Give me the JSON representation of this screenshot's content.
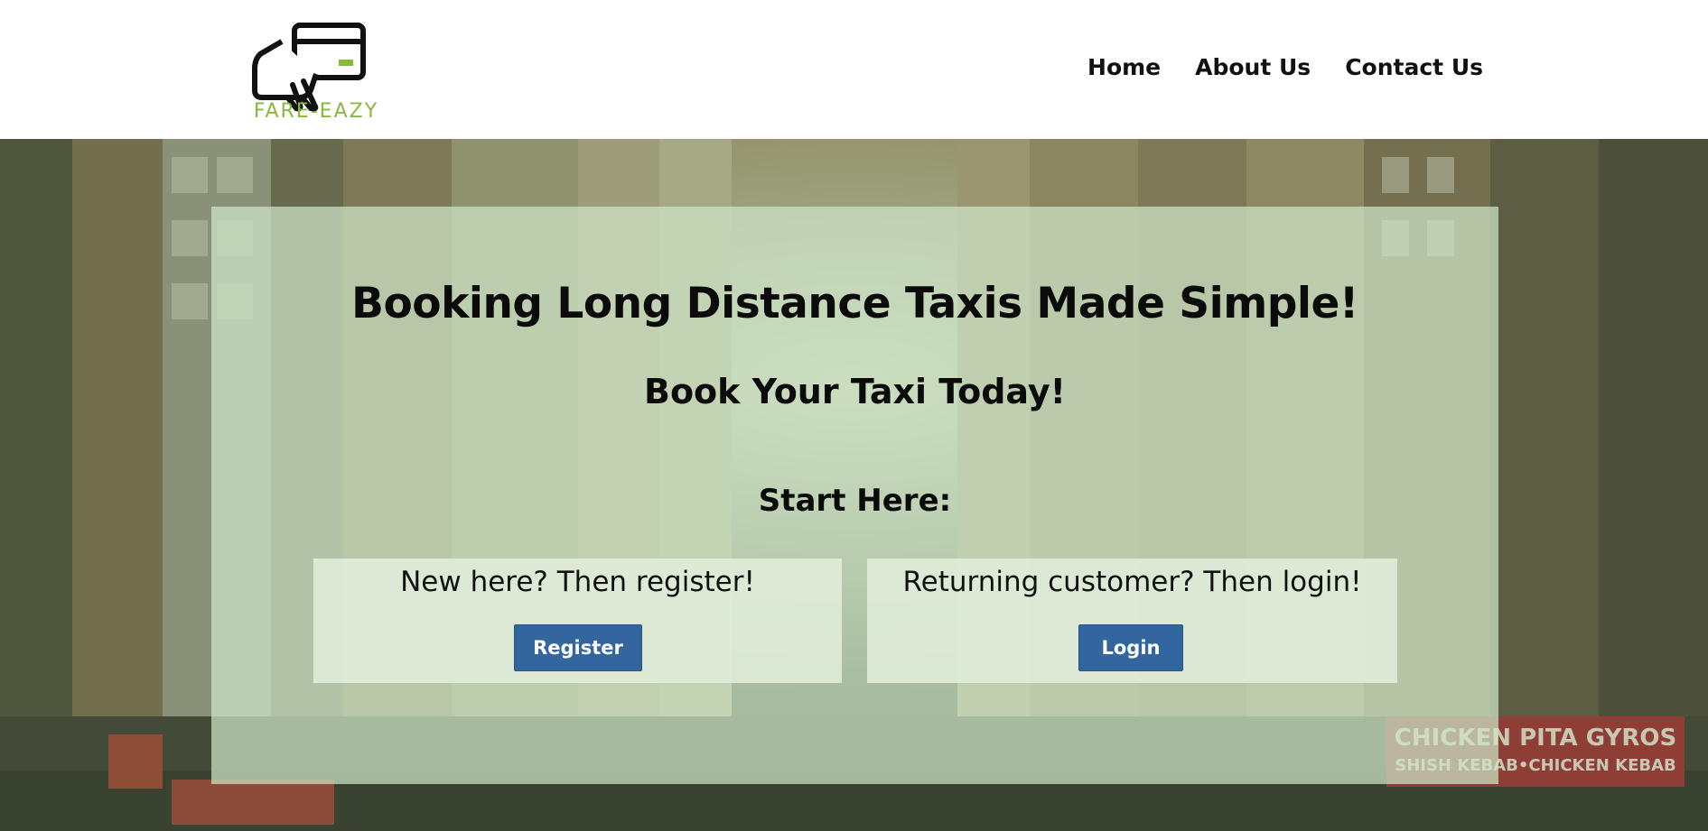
{
  "header": {
    "logo_text": "FARE-EAZY",
    "nav": [
      {
        "label": "Home"
      },
      {
        "label": "About Us"
      },
      {
        "label": "Contact Us"
      }
    ]
  },
  "hero": {
    "headline": "Booking Long Distance Taxis Made Simple!",
    "subheadline": "Book Your Taxi Today!",
    "start_label": "Start Here:",
    "register_card": {
      "prompt": "New here? Then register!",
      "button_label": "Register"
    },
    "login_card": {
      "prompt": "Returning customer? Then login!",
      "button_label": "Login"
    },
    "background_image_text": {
      "storefront_sign_line1": "CHICKEN PITA GYROS",
      "storefront_sign_line2": "SHISH KEBAB•CHICKEN KEBAB"
    }
  },
  "colors": {
    "brand_green": "#8ab83d",
    "button_blue": "#33659e",
    "panel_tint": "#cfe4c8",
    "sign_red": "#a3282b"
  },
  "icons": {
    "logo_icon": "hand-holding-card-icon"
  }
}
